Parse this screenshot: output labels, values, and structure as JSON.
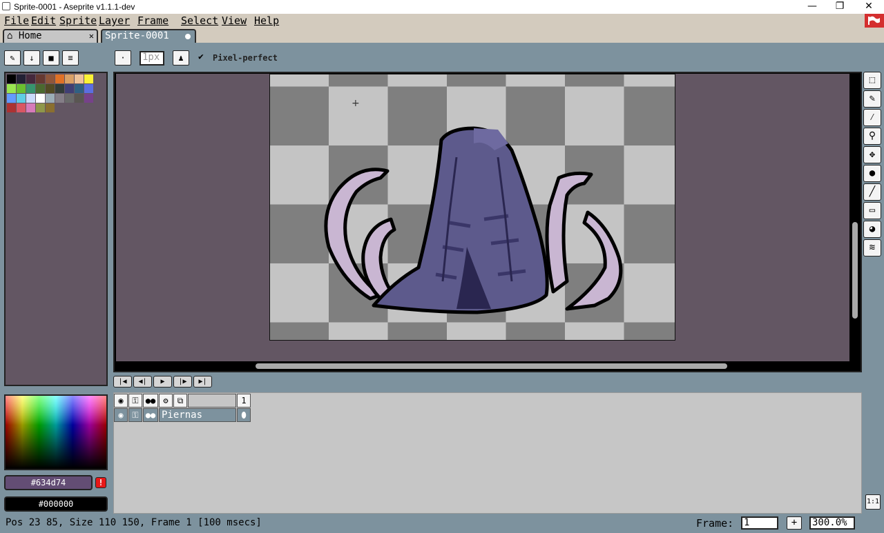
{
  "window": {
    "title": "Sprite-0001 - Aseprite v1.1.1-dev",
    "min": "—",
    "restore": "❐",
    "close": "✕"
  },
  "menu": [
    "File",
    "Edit",
    "Sprite",
    "Layer",
    "Frame",
    "Select",
    "View",
    "Help"
  ],
  "tabs": {
    "home": "Home",
    "home_close": "✕",
    "sprite": "Sprite-0001"
  },
  "toolbar": {
    "brush_size": "1px",
    "pixel_perfect": "Pixel-perfect"
  },
  "colors": {
    "accent": "#d42f2f",
    "panel": "#7d929e",
    "canvas_bg": "#635663",
    "palette": [
      "#000000",
      "#222034",
      "#45283c",
      "#663931",
      "#8f563b",
      "#df7126",
      "#d9a066",
      "#eec39a",
      "#fbf236",
      "#99e550",
      "#6abe30",
      "#37946e",
      "#4b692f",
      "#524b24",
      "#323c39",
      "#3f3f74",
      "#306082",
      "#5b6ee1",
      "#639bff",
      "#5fcde4",
      "#cbdbfc",
      "#ffffff",
      "#9badb7",
      "#847e87",
      "#696a6a",
      "#595652",
      "#76428a",
      "#ac3232",
      "#d95763",
      "#d77bba",
      "#8f974a",
      "#8a6f30"
    ]
  },
  "fg_color": {
    "label": "#634d74",
    "value": "#634d74"
  },
  "bg_color": {
    "label": "#000000",
    "value": "#000000"
  },
  "timeline": {
    "frame_number": "1",
    "layer_name": "Piernas"
  },
  "status": {
    "text": "Pos 23 85, Size 110 150, Frame 1 [100 msecs]",
    "frame_label": "Frame:",
    "frame_value": "1",
    "zoom": "300.0%",
    "plus": "+",
    "one_to_one": "1:1"
  }
}
